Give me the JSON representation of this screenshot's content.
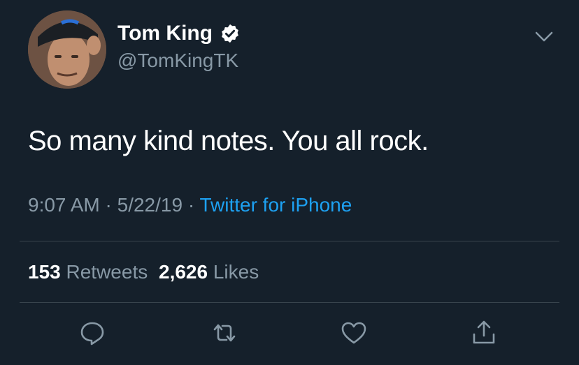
{
  "tweet": {
    "author": {
      "name": "Tom King",
      "handle": "@TomKingTK",
      "verified": true,
      "avatar_icon": "avatar-photo"
    },
    "text": "So many kind notes. You all rock.",
    "time": "9:07 AM",
    "date": "5/22/19",
    "separator": "·",
    "source": "Twitter for iPhone",
    "stats": {
      "retweets_count": "153",
      "retweets_label": "Retweets",
      "likes_count": "2,626",
      "likes_label": "Likes"
    },
    "actions": [
      {
        "icon": "reply-icon"
      },
      {
        "icon": "retweet-icon"
      },
      {
        "icon": "like-icon"
      },
      {
        "icon": "share-icon"
      }
    ]
  },
  "colors": {
    "background": "#15202b",
    "text": "#ffffff",
    "secondary": "#8899a6",
    "accent": "#1da1f2",
    "divider": "#38444d"
  }
}
